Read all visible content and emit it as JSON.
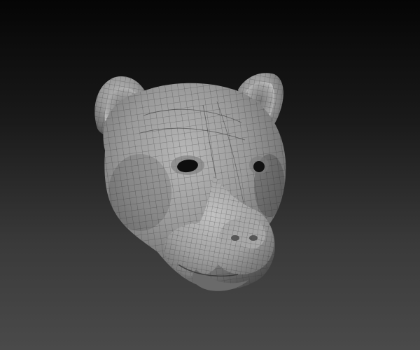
{
  "viewport": {
    "background_top": "#050505",
    "background_bottom": "#4a4a4a"
  },
  "model": {
    "subject": "cougar-head-sculpt",
    "display": "wireframe-over-shaded",
    "surface_color": "#8c8c8c",
    "wire_color": "#2b2b2b"
  }
}
